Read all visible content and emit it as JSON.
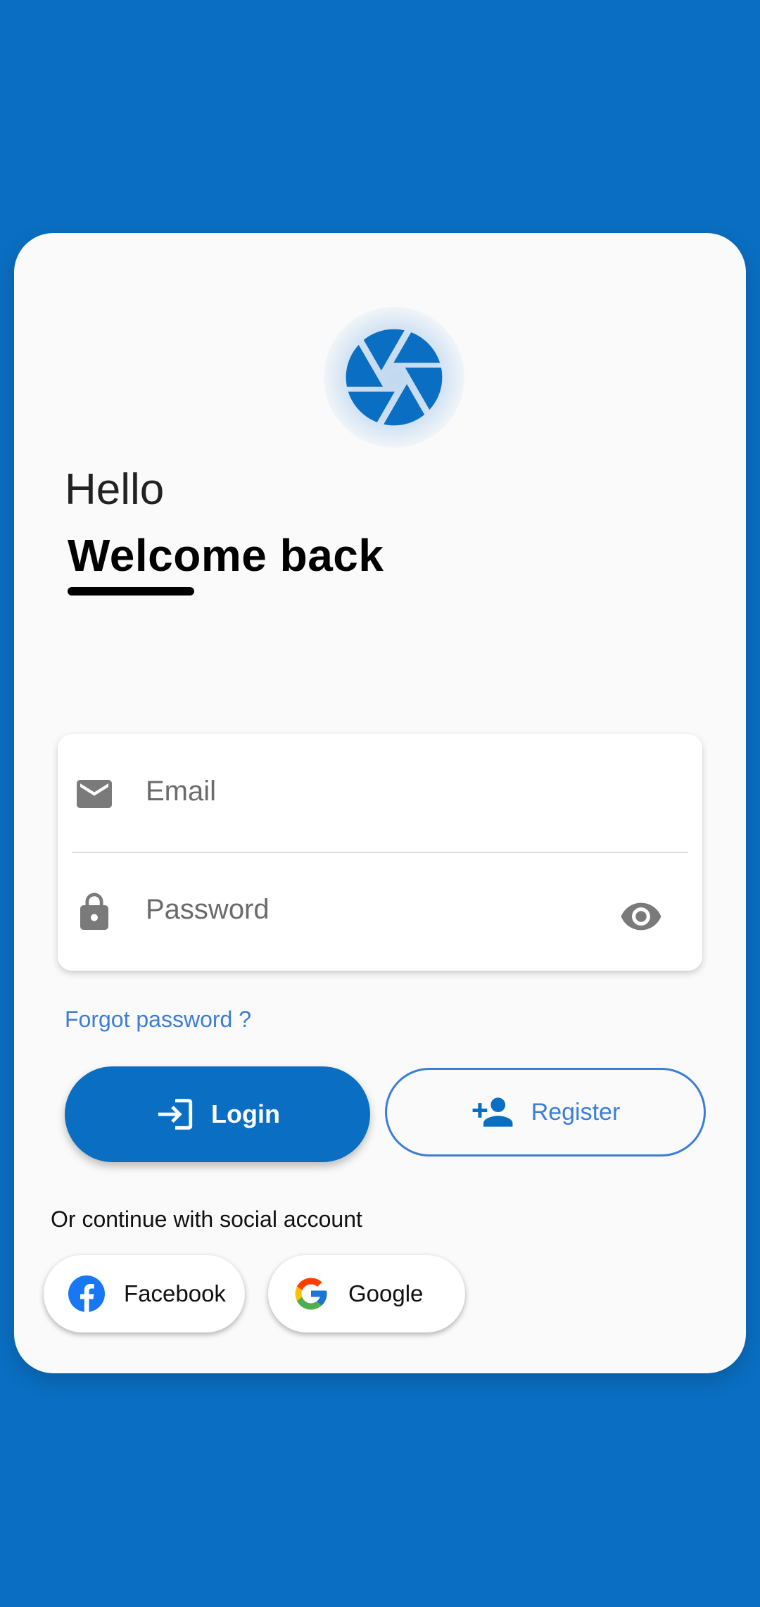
{
  "colors": {
    "background": "#0A6FC2",
    "card": "#FAFAFA",
    "primary": "#0A6FC2",
    "link": "#3C7DD8",
    "icon_gray": "#7A7A7A"
  },
  "logo": {
    "icon": "camera-aperture-icon"
  },
  "greeting": {
    "hello": "Hello",
    "welcome": "Welcome back"
  },
  "form": {
    "email": {
      "placeholder": "Email",
      "value": "",
      "icon": "mail-icon"
    },
    "password": {
      "placeholder": "Password",
      "value": "",
      "icon": "lock-icon",
      "toggle_icon": "eye-icon"
    }
  },
  "forgot_password": "Forgot password ?",
  "buttons": {
    "login": {
      "label": "Login",
      "icon": "login-icon"
    },
    "register": {
      "label": "Register",
      "icon": "add-person-icon"
    }
  },
  "social": {
    "heading": "Or continue with social account",
    "facebook": {
      "label": "Facebook",
      "icon": "facebook-icon"
    },
    "google": {
      "label": "Google",
      "icon": "google-icon"
    }
  }
}
